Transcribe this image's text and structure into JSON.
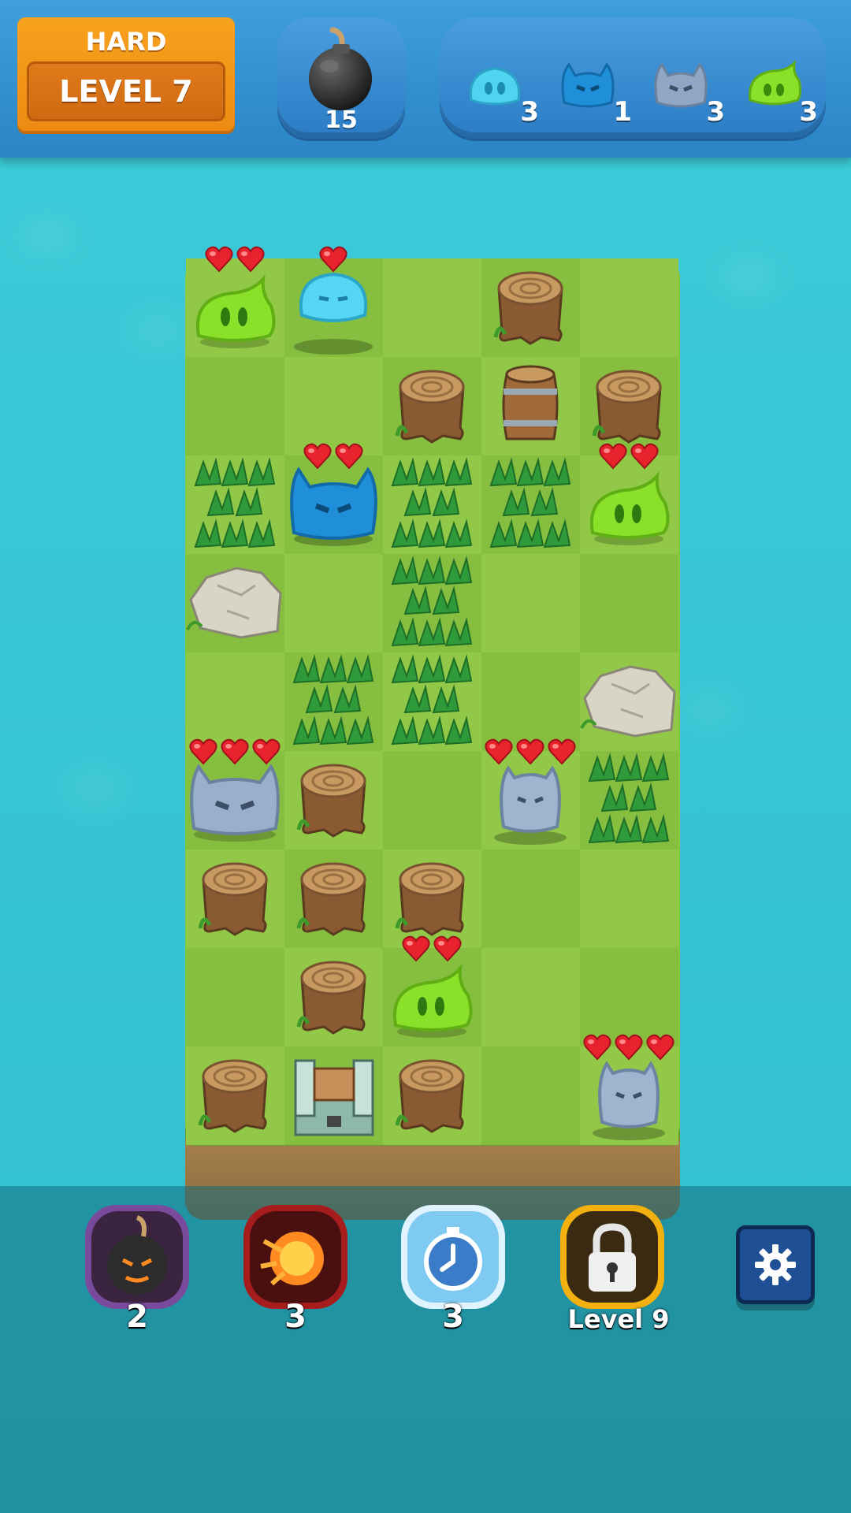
{
  "header": {
    "difficulty": "HARD",
    "level_label": "LEVEL 7",
    "bombs_remaining": "15",
    "targets": [
      {
        "name": "cyan-slime",
        "count": "3",
        "color": "#4fd4f0"
      },
      {
        "name": "blue-horned-slime",
        "count": "1",
        "color": "#1e8fd8"
      },
      {
        "name": "gray-horned-slime",
        "count": "3",
        "color": "#8fa7c4"
      },
      {
        "name": "green-slime",
        "count": "3",
        "color": "#8be02a"
      }
    ]
  },
  "board": {
    "columns": 5,
    "rows": 9,
    "pieces": [
      {
        "type": "green-slime",
        "col": 0,
        "row": 0,
        "hearts": 2
      },
      {
        "type": "cyan-slime",
        "col": 1,
        "row": 0,
        "hearts": 1
      },
      {
        "type": "stump",
        "col": 3,
        "row": 0
      },
      {
        "type": "stump",
        "col": 2,
        "row": 1
      },
      {
        "type": "barrel",
        "col": 3,
        "row": 1
      },
      {
        "type": "stump",
        "col": 4,
        "row": 1
      },
      {
        "type": "grass",
        "col": 0,
        "row": 2
      },
      {
        "type": "blue-horned-slime",
        "col": 1,
        "row": 2,
        "hearts": 2
      },
      {
        "type": "grass",
        "col": 2,
        "row": 2
      },
      {
        "type": "grass",
        "col": 3,
        "row": 2
      },
      {
        "type": "green-slime",
        "col": 4,
        "row": 2,
        "hearts": 2
      },
      {
        "type": "rock",
        "col": 0,
        "row": 3
      },
      {
        "type": "grass",
        "col": 2,
        "row": 3
      },
      {
        "type": "grass",
        "col": 1,
        "row": 4
      },
      {
        "type": "grass",
        "col": 2,
        "row": 4
      },
      {
        "type": "rock",
        "col": 4,
        "row": 4
      },
      {
        "type": "gray-horned-slime",
        "col": 0,
        "row": 5,
        "hearts": 3
      },
      {
        "type": "stump",
        "col": 1,
        "row": 5
      },
      {
        "type": "gray-ghost-slime",
        "col": 3,
        "row": 5,
        "hearts": 3
      },
      {
        "type": "grass",
        "col": 4,
        "row": 5
      },
      {
        "type": "stump",
        "col": 0,
        "row": 6
      },
      {
        "type": "stump",
        "col": 1,
        "row": 6
      },
      {
        "type": "stump",
        "col": 2,
        "row": 6
      },
      {
        "type": "stump",
        "col": 1,
        "row": 7
      },
      {
        "type": "green-slime",
        "col": 2,
        "row": 7,
        "hearts": 2
      },
      {
        "type": "stump",
        "col": 0,
        "row": 8
      },
      {
        "type": "crate",
        "col": 1,
        "row": 8
      },
      {
        "type": "stump",
        "col": 2,
        "row": 8
      },
      {
        "type": "gray-ghost-slime",
        "col": 4,
        "row": 8,
        "hearts": 3
      }
    ]
  },
  "boosters": [
    {
      "name": "bomb-booster",
      "count": "2",
      "icon": "bomb-icon"
    },
    {
      "name": "fireball-booster",
      "count": "3",
      "icon": "fireball-icon"
    },
    {
      "name": "freeze-time-booster",
      "count": "3",
      "icon": "stopwatch-icon"
    },
    {
      "name": "locked-booster",
      "label": "Level 9",
      "icon": "lock-icon"
    }
  ],
  "settings_icon": "gear-icon",
  "colors": {
    "header": "#2f8fd2",
    "level_badge": "#f29a1a",
    "board_grass": "#8cc540",
    "water": "#38c6d4",
    "heart": "#e8232e"
  }
}
